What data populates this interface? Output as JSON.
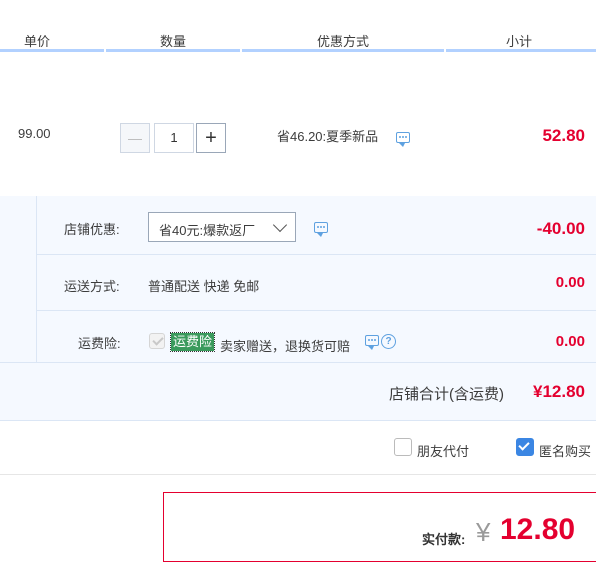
{
  "header": {
    "col_price": "单价",
    "col_qty": "数量",
    "col_discount": "优惠方式",
    "col_subtotal": "小计"
  },
  "item": {
    "unit_price": "99.00",
    "quantity": "1",
    "minus_symbol": "—",
    "plus_symbol": "+",
    "discount_text": "省46.20:夏季新品",
    "subtotal": "52.80"
  },
  "shop": {
    "discount_label": "店铺优惠:",
    "discount_selected": "省40元:爆款返厂",
    "discount_amount": "-40.00",
    "shipping_label": "运送方式:",
    "shipping_value": "普通配送 快递 免邮",
    "shipping_amount": "0.00",
    "insurance_label": "运费险:",
    "insurance_tag": "运费险",
    "insurance_desc": "卖家赠送，退换货可赔",
    "insurance_amount": "0.00",
    "total_label": "店铺合计(含运费)",
    "total_value": "¥12.80"
  },
  "options": {
    "friend_pay": "朋友代付",
    "anonymous": "匿名购买"
  },
  "payment": {
    "label": "实付款:",
    "currency": "¥",
    "amount": "12.80"
  },
  "colors": {
    "accent_red": "#e4002f",
    "tag_green": "#3a9a5c",
    "link_blue": "#5ea1e0",
    "check_blue": "#3b86e3"
  }
}
